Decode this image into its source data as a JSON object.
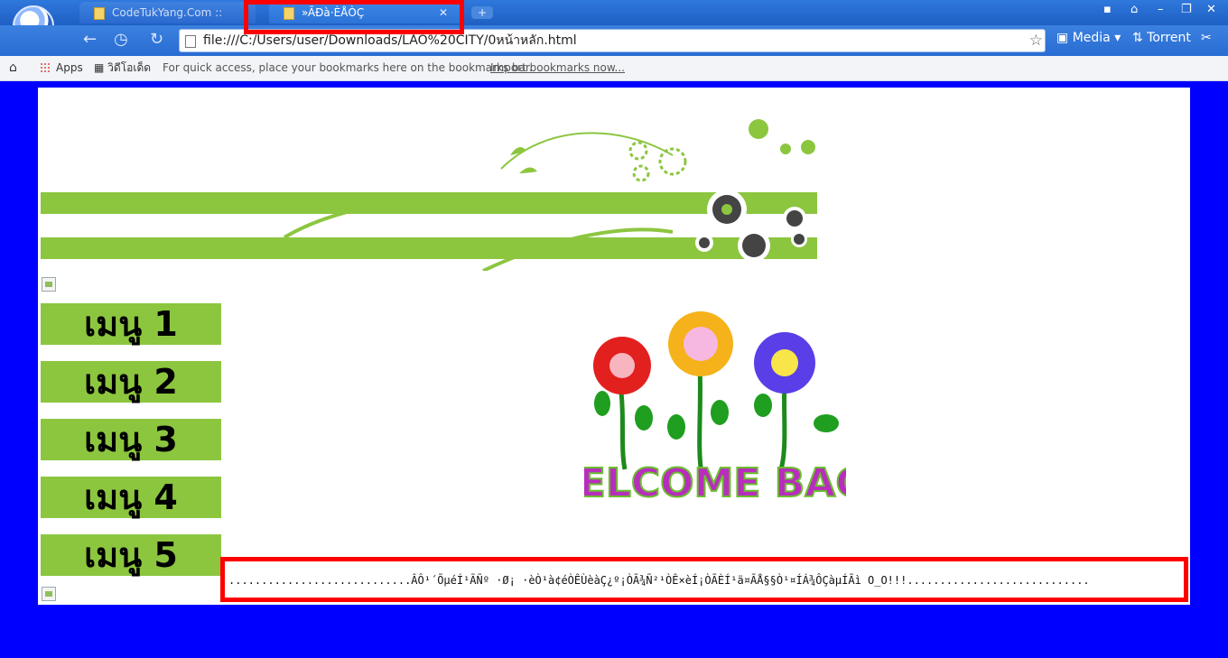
{
  "browser": {
    "tabs": [
      {
        "title": "CodeTukYang.Com :: รวมแ...",
        "active": false
      },
      {
        "title": "»ÃÐà·ÈÅÒÇ",
        "active": true
      }
    ],
    "url": "file:///C:/Users/user/Downloads/LAO%20CITY/0หน้าหลัก.html",
    "extensions": {
      "media": "Media",
      "torrent": "Torrent"
    },
    "bookmarks_bar": {
      "apps": "Apps",
      "video": "วิดีโอเด็ด",
      "hint": "For quick access, place your bookmarks here on the bookmarks bar.",
      "import_link": "Import bookmarks now..."
    }
  },
  "page": {
    "menu": [
      "เมนู 1",
      "เมนู 2",
      "เมนู 3",
      "เมนู 4",
      "เมนู 5"
    ],
    "marquee": "............................ÂÔ¹´ÕµéÍ¹ÃÑº ·Ø¡ ·èÒ¹à¢éÒÊÙèàÇ¿º¡ÒÃ¾Ñ²¹ÒÊ×èÍ¡ÒÃÈÍ¹ä¤ÃÅ§§Ò¹¤ÍÁ¾ÔÇàµÍÃì     O_O!!!............................",
    "welcome_image_text": "WELCOME BACK"
  },
  "colors": {
    "page_bg": "#0000ff",
    "menu_bg": "#8cc63f",
    "highlight": "#ff0000"
  }
}
